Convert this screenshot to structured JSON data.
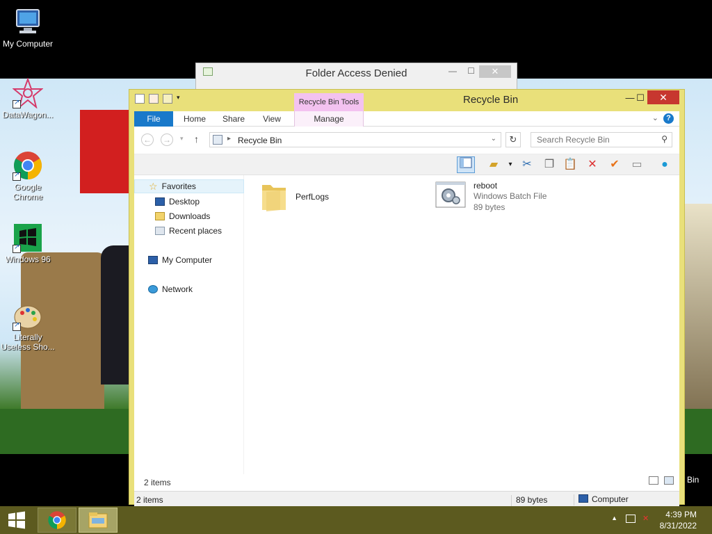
{
  "desktop": {
    "icons": [
      {
        "label": "My Computer"
      },
      {
        "label": "DataWagon..."
      },
      {
        "label": "Google Chrome"
      },
      {
        "label": "Windows 96"
      },
      {
        "label": "Literally Useless Sho..."
      }
    ],
    "partial_label": "Bin"
  },
  "dialog": {
    "title": "Folder Access Denied",
    "close": "✕"
  },
  "explorer": {
    "title": "Recycle Bin",
    "contextual_tab": "Recycle Bin Tools",
    "ribbon_tabs": [
      "File",
      "Home",
      "Share",
      "View",
      "Manage"
    ],
    "address": {
      "crumb": "Recycle Bin"
    },
    "search": {
      "placeholder": "Search Recycle Bin"
    },
    "nav": {
      "favorites": "Favorites",
      "desktop": "Desktop",
      "downloads": "Downloads",
      "recent": "Recent places",
      "my_computer": "My Computer",
      "network": "Network"
    },
    "items": [
      {
        "name": "PerfLogs"
      },
      {
        "name": "reboot",
        "type": "Windows Batch File",
        "size": "89 bytes"
      }
    ],
    "status": {
      "count": "2 items",
      "count_bar": "2 items",
      "size": "89 bytes",
      "zone": "Computer"
    },
    "accent": "#e9e07a",
    "file_tab_color": "#1979ca"
  },
  "taskbar": {
    "time": "4:39 PM",
    "date": "8/31/2022",
    "color": "#5c5a1f"
  }
}
